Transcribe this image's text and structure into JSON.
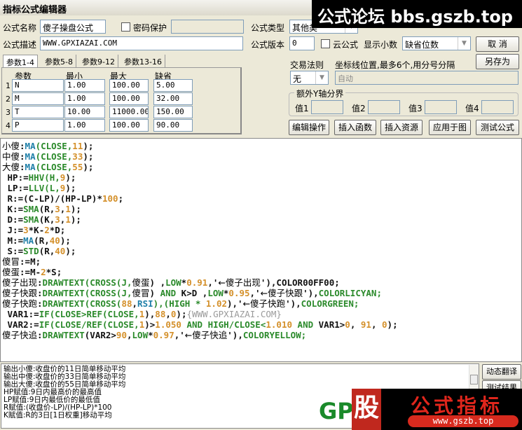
{
  "window": {
    "title": "指标公式编辑器"
  },
  "form": {
    "name_label": "公式名称",
    "name_value": "傻子操盘公式",
    "password_label": "密码保护",
    "password_value": "",
    "desc_label": "公式描述",
    "desc_value": "WWW.GPXIAZAI.COM",
    "type_label": "公式类型",
    "type_value": "其他类",
    "version_label": "公式版本",
    "version_value": "0",
    "cloud_label": "云公式",
    "decimal_label": "显示小数",
    "decimal_value": "缺省位数",
    "trade_rule_label": "交易法则",
    "trade_rule_value": "无",
    "axis_label": "坐标线位置,最多6个,用分号分隔",
    "axis_value": "自动",
    "yaxis_group": "额外Y轴分界",
    "yaxis_values": [
      "值1",
      "值2",
      "值3",
      "值4"
    ]
  },
  "buttons": {
    "cancel": "取  消",
    "save_as": "另存为",
    "edit_ops": "编辑操作",
    "insert_func": "插入函数",
    "insert_res": "插入资源",
    "apply": "应用于图",
    "test": "测试公式",
    "dyn_translate": "动态翻译",
    "test_result": "测试结果"
  },
  "tabs": [
    "参数1-4",
    "参数5-8",
    "参数9-12",
    "参数13-16"
  ],
  "params": {
    "headers": [
      "参数",
      "最小",
      "最大",
      "缺省"
    ],
    "rows": [
      [
        "1",
        "N",
        "1.00",
        "100.00",
        "5.00"
      ],
      [
        "2",
        "M",
        "1.00",
        "100.00",
        "32.00"
      ],
      [
        "3",
        "T",
        "10.00",
        "11000.00",
        "150.00"
      ],
      [
        "4",
        "P",
        "1.00",
        "100.00",
        "90.00"
      ]
    ]
  },
  "code": [
    [
      [
        "小傻",
        "h"
      ],
      [
        ":",
        "t"
      ],
      [
        "MA",
        "m"
      ],
      [
        "(CLOSE,",
        "f"
      ],
      [
        "11",
        "n"
      ],
      [
        ");",
        "t"
      ]
    ],
    [
      [
        "中傻",
        "h"
      ],
      [
        ":",
        "t"
      ],
      [
        "MA",
        "m"
      ],
      [
        "(CLOSE,",
        "f"
      ],
      [
        "33",
        "n"
      ],
      [
        ");",
        "t"
      ]
    ],
    [
      [
        "大傻",
        "h"
      ],
      [
        ":",
        "t"
      ],
      [
        "MA",
        "m"
      ],
      [
        "(CLOSE,",
        "f"
      ],
      [
        "55",
        "n"
      ],
      [
        ");",
        "t"
      ]
    ],
    [
      [
        " HP:=",
        "t"
      ],
      [
        "HHV",
        "f"
      ],
      [
        "(H,",
        "f"
      ],
      [
        "9",
        "n"
      ],
      [
        ");",
        "t"
      ]
    ],
    [
      [
        " LP:=",
        "t"
      ],
      [
        "LLV",
        "f"
      ],
      [
        "(L,",
        "f"
      ],
      [
        "9",
        "n"
      ],
      [
        ");",
        "t"
      ]
    ],
    [
      [
        " R:=(C-LP)/(HP-LP)*",
        "t"
      ],
      [
        "100",
        "n"
      ],
      [
        ";",
        "t"
      ]
    ],
    [
      [
        " K:=",
        "t"
      ],
      [
        "SMA",
        "f"
      ],
      [
        "(R,",
        "t"
      ],
      [
        "3",
        "n"
      ],
      [
        ",",
        "t"
      ],
      [
        "1",
        "n"
      ],
      [
        ");",
        "t"
      ]
    ],
    [
      [
        " D:=",
        "t"
      ],
      [
        "SMA",
        "f"
      ],
      [
        "(K,",
        "t"
      ],
      [
        "3",
        "n"
      ],
      [
        ",",
        "t"
      ],
      [
        "1",
        "n"
      ],
      [
        ");",
        "t"
      ]
    ],
    [
      [
        " J:=",
        "t"
      ],
      [
        "3",
        "n"
      ],
      [
        "*K-",
        "t"
      ],
      [
        "2",
        "n"
      ],
      [
        "*D;",
        "t"
      ]
    ],
    [
      [
        " M:=",
        "t"
      ],
      [
        "MA",
        "m"
      ],
      [
        "(R,",
        "t"
      ],
      [
        "40",
        "n"
      ],
      [
        ");",
        "t"
      ]
    ],
    [
      [
        " S:=",
        "t"
      ],
      [
        "STD",
        "f"
      ],
      [
        "(R,",
        "t"
      ],
      [
        "40",
        "n"
      ],
      [
        ");",
        "t"
      ]
    ],
    [
      [
        "傻冒",
        "h"
      ],
      [
        ":=M;",
        "t"
      ]
    ],
    [
      [
        "傻蛋",
        "h"
      ],
      [
        ":=M-",
        "t"
      ],
      [
        "2",
        "n"
      ],
      [
        "*S;",
        "t"
      ]
    ],
    [
      [
        "傻子出现",
        "h"
      ],
      [
        ":",
        "t"
      ],
      [
        "DRAWTEXT",
        "f"
      ],
      [
        "(CROSS(J,",
        "f"
      ],
      [
        "傻蛋",
        "h"
      ],
      [
        ") ,",
        "t"
      ],
      [
        "LOW",
        "f"
      ],
      [
        "*",
        "t"
      ],
      [
        "0.91",
        "n"
      ],
      [
        ",'",
        "t"
      ],
      [
        "←傻子出现",
        "h"
      ],
      [
        "'),COLOR00FF00;",
        "t"
      ]
    ],
    [
      [
        "傻子快跟",
        "h"
      ],
      [
        ":",
        "t"
      ],
      [
        "DRAWTEXT",
        "f"
      ],
      [
        "(CROSS(J,",
        "f"
      ],
      [
        "傻冒",
        "h"
      ],
      [
        ") ",
        "t"
      ],
      [
        "AND",
        "f"
      ],
      [
        " K>D ,",
        "t"
      ],
      [
        "LOW",
        "f"
      ],
      [
        "*",
        "t"
      ],
      [
        "0.95",
        "n"
      ],
      [
        ",'",
        "t"
      ],
      [
        "←傻子快跟",
        "h"
      ],
      [
        "'),",
        "t"
      ],
      [
        "COLORLICYAN;",
        "f"
      ]
    ],
    [
      [
        "傻子快跑",
        "h"
      ],
      [
        ":",
        "t"
      ],
      [
        "DRAWTEXT",
        "f"
      ],
      [
        "(CROSS(",
        "f"
      ],
      [
        "88",
        "n"
      ],
      [
        ",",
        "t"
      ],
      [
        "RSI",
        "m"
      ],
      [
        "),(HIGH * ",
        "f"
      ],
      [
        "1.02",
        "n"
      ],
      [
        "),'",
        "t"
      ],
      [
        "←傻子快跑",
        "h"
      ],
      [
        "'),",
        "t"
      ],
      [
        "COLORGREEN;",
        "f"
      ]
    ],
    [
      [
        " VAR1:=",
        "t"
      ],
      [
        "IF",
        "f"
      ],
      [
        "(CLOSE>",
        "f"
      ],
      [
        "REF",
        "f"
      ],
      [
        "(CLOSE,",
        "f"
      ],
      [
        "1",
        "n"
      ],
      [
        "),",
        "t"
      ],
      [
        "88",
        "n"
      ],
      [
        ",",
        "t"
      ],
      [
        "0",
        "n"
      ],
      [
        ");",
        "t"
      ],
      [
        "{WWW.GPXIAZAI.COM}",
        "c"
      ]
    ],
    [
      [
        " VAR2:=",
        "t"
      ],
      [
        "IF",
        "f"
      ],
      [
        "(CLOSE/",
        "f"
      ],
      [
        "REF",
        "f"
      ],
      [
        "(CLOSE,",
        "f"
      ],
      [
        "1",
        "n"
      ],
      [
        ")>",
        "t"
      ],
      [
        "1.050",
        "n"
      ],
      [
        " AND ",
        "f"
      ],
      [
        "HIGH/CLOSE<",
        "f"
      ],
      [
        "1.010",
        "n"
      ],
      [
        " AND ",
        "f"
      ],
      [
        "VAR1>",
        "t"
      ],
      [
        "0",
        "n"
      ],
      [
        ", ",
        "t"
      ],
      [
        "91",
        "n"
      ],
      [
        ", ",
        "t"
      ],
      [
        "0",
        "n"
      ],
      [
        ");",
        "t"
      ]
    ],
    [
      [
        "傻子快追",
        "h"
      ],
      [
        ":",
        "t"
      ],
      [
        "DRAWTEXT",
        "f"
      ],
      [
        "(VAR2>",
        "t"
      ],
      [
        "90",
        "n"
      ],
      [
        ",",
        "t"
      ],
      [
        "LOW",
        "f"
      ],
      [
        "*",
        "t"
      ],
      [
        "0.97",
        "n"
      ],
      [
        ",'",
        "t"
      ],
      [
        "←傻子快追",
        "h"
      ],
      [
        "'),",
        "t"
      ],
      [
        "COLORYELLOW;",
        "f"
      ]
    ]
  ],
  "output_lines": [
    "输出小傻:收盘价的11日简单移动平均",
    "输出中傻:收盘价的33日简单移动平均",
    "输出大傻:收盘价的55日简单移动平均",
    "HP赋值:9日内最高价的最高值",
    "LP赋值:9日内最低价的最低值",
    "R赋值:(收盘价-LP)/(HP-LP)*100",
    "K赋值:R的3日[1日权重]移动平均"
  ],
  "watermarks": {
    "top": "公式论坛 bbs.gszb.top",
    "bottom_big": "股",
    "bottom_title": "公式指标",
    "bottom_url": "www.gszb.top",
    "gp": "GP"
  }
}
